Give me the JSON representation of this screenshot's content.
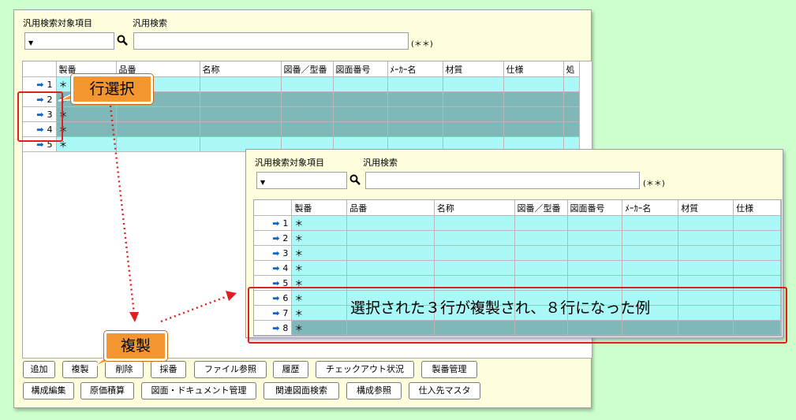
{
  "search_area": {
    "field_label": "汎用検索対象項目",
    "search_label": "汎用検索",
    "note": "(＊＊)"
  },
  "grid": {
    "columns": [
      "製番",
      "品番",
      "名称",
      "図番／型番",
      "図面番号",
      "ﾒｰｶｰ名",
      "材質",
      "仕様",
      "処"
    ],
    "rows": [
      {
        "num": "1",
        "seiban": "＊"
      },
      {
        "num": "2",
        "seiban": "＊"
      },
      {
        "num": "3",
        "seiban": "＊"
      },
      {
        "num": "4",
        "seiban": "＊"
      },
      {
        "num": "5",
        "seiban": "＊"
      }
    ]
  },
  "grid2": {
    "columns": [
      "製番",
      "品番",
      "名称",
      "図番／型番",
      "図面番号",
      "ﾒｰｶｰ名",
      "材質",
      "仕様"
    ],
    "rows": [
      {
        "num": "1",
        "seiban": "＊"
      },
      {
        "num": "2",
        "seiban": "＊"
      },
      {
        "num": "3",
        "seiban": "＊"
      },
      {
        "num": "4",
        "seiban": "＊"
      },
      {
        "num": "5",
        "seiban": "＊"
      },
      {
        "num": "6",
        "seiban": "＊"
      },
      {
        "num": "7",
        "seiban": "＊"
      },
      {
        "num": "8",
        "seiban": "＊"
      }
    ]
  },
  "buttons_row1": [
    "追加",
    "複製",
    "削除",
    "採番",
    "ファイル参照",
    "履歴",
    "チェックアウト状況",
    "製番管理"
  ],
  "buttons_row2": [
    "構成編集",
    "原価積算",
    "図面・ドキュメント管理",
    "関連図面検索",
    "構成参照",
    "仕入先マスタ"
  ],
  "annotations": {
    "row_select": "行選択",
    "duplicate": "複製",
    "result": "選択された３行が複製され、８行になった例"
  },
  "colors": {
    "background": "#ccffcc",
    "panel": "#ffffde",
    "row_normal": "#aaf8f8",
    "row_selected": "#7fb8b8",
    "callout": "#f3962f",
    "highlight": "#e02020",
    "arrow": "#1166cc"
  },
  "icons": [
    "search-icon",
    "dropdown-caret-icon",
    "row-arrow-icon"
  ]
}
